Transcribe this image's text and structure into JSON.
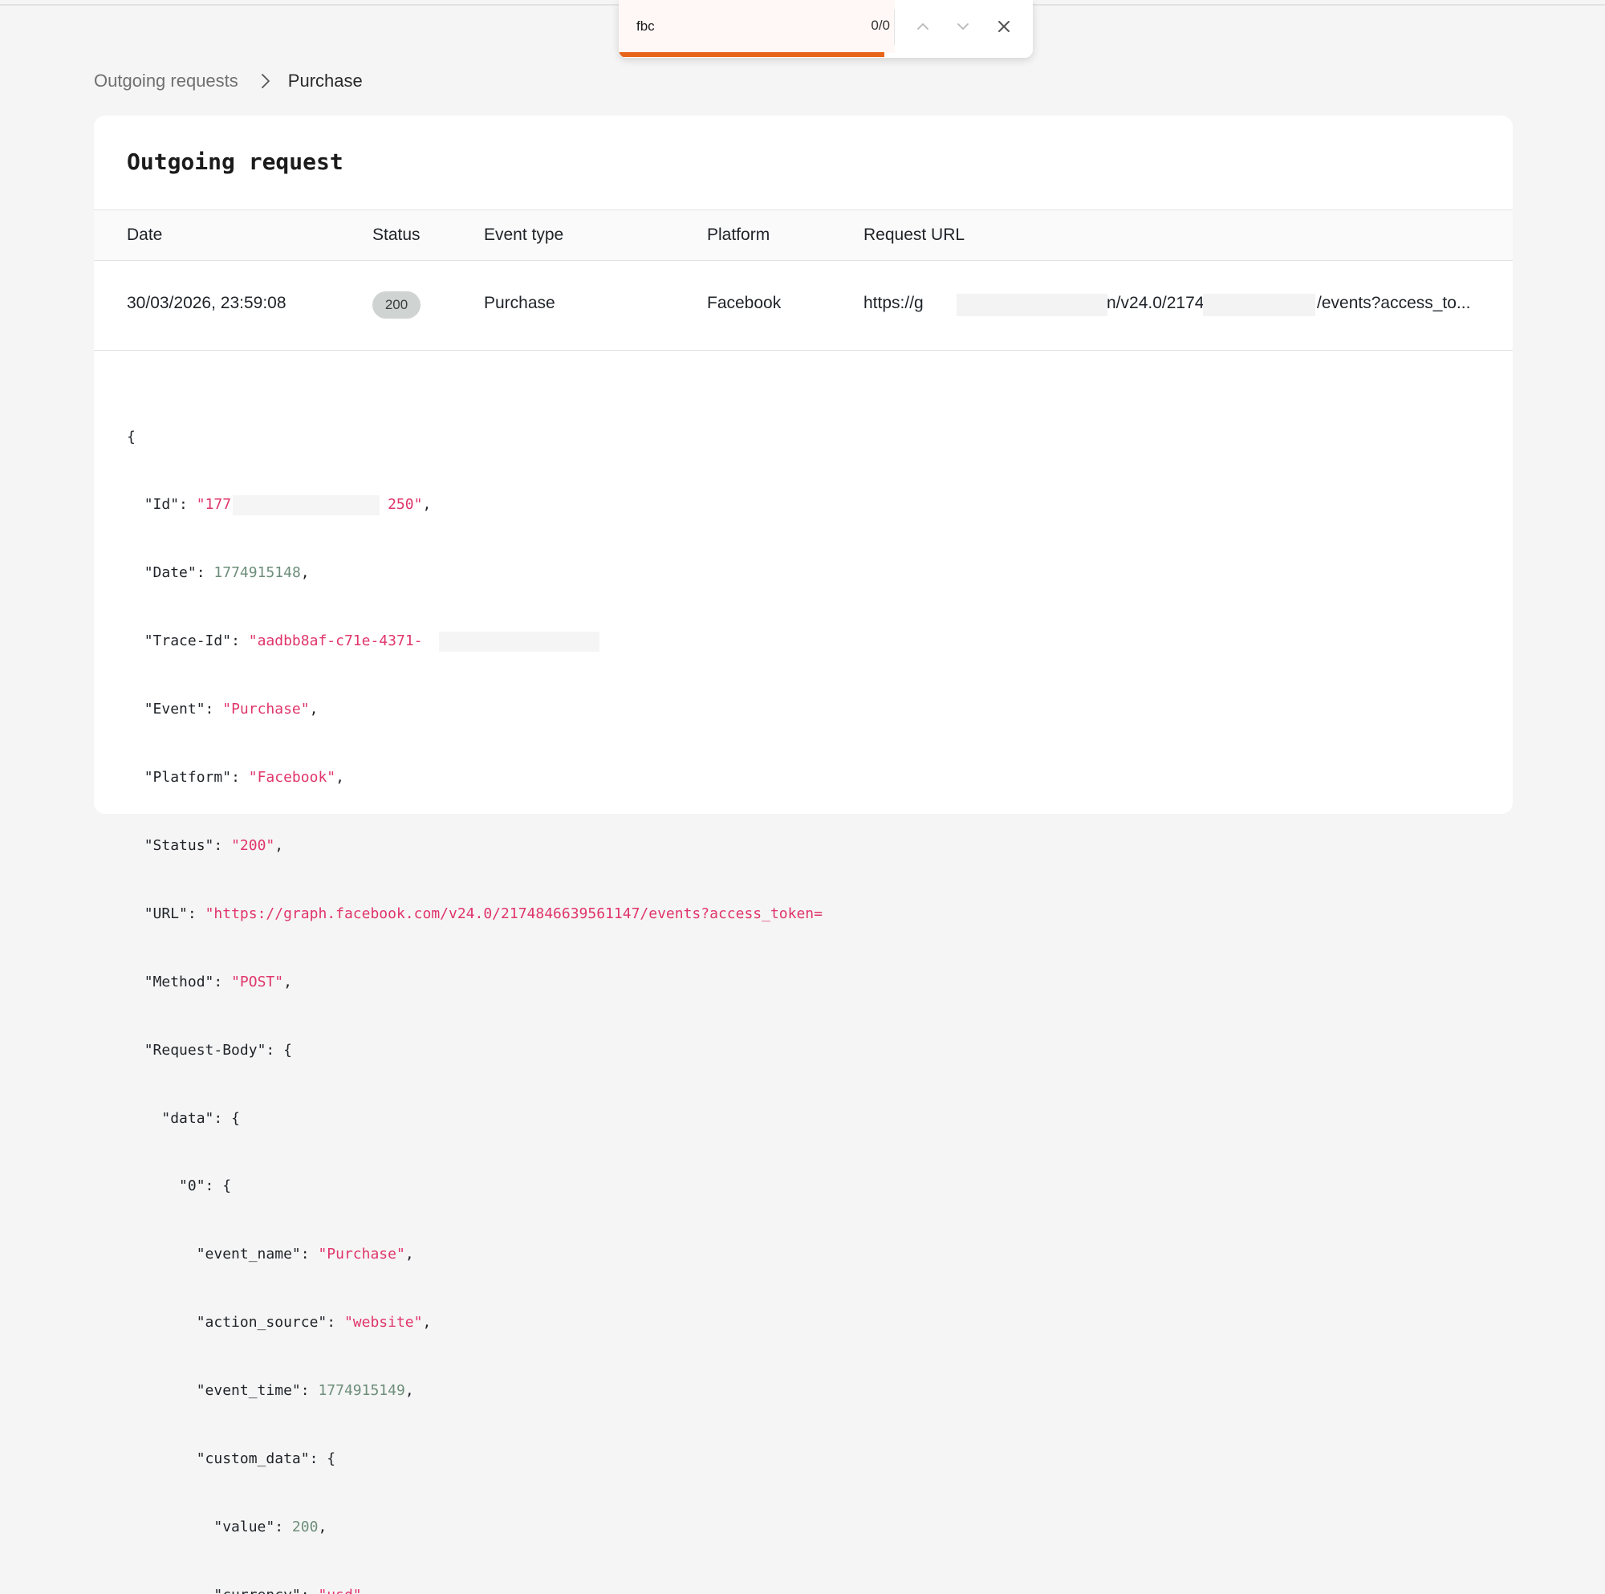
{
  "find_bar": {
    "query": "fbc",
    "match_count": "0/0",
    "icons": {
      "prev": "chevron-up-icon",
      "next": "chevron-down-icon",
      "close": "close-icon"
    }
  },
  "breadcrumb": {
    "parent": "Outgoing requests",
    "current": "Purchase",
    "separator_icon": "chevron-right-icon"
  },
  "card": {
    "title": "Outgoing request",
    "columns": [
      "Date",
      "Status",
      "Event type",
      "Platform",
      "Request URL"
    ],
    "row": {
      "date": "30/03/2026, 23:59:08",
      "status": "200",
      "event_type": "Purchase",
      "platform": "Facebook",
      "url_parts": [
        "https://g",
        "n/v24.0/21748",
        "/events?access_to..."
      ]
    }
  },
  "json_view": {
    "open": "{",
    "id": {
      "key": "\"Id\"",
      "value_start": "\"177",
      "value_end": "250\""
    },
    "date": {
      "key": "\"Date\"",
      "value": "1774915148"
    },
    "trace_id": {
      "key": "\"Trace-Id\"",
      "value_start": "\"aadbb8af-c71e-4371-",
      "value_end": "'"
    },
    "event": {
      "key": "\"Event\"",
      "value": "\"Purchase\""
    },
    "platform": {
      "key": "\"Platform\"",
      "value": "\"Facebook\""
    },
    "status": {
      "key": "\"Status\"",
      "value": "\"200\""
    },
    "url": {
      "key": "\"URL\"",
      "value": "\"https://graph.facebook.com/v24.0/2174846639561147/events?access_token="
    },
    "method": {
      "key": "\"Method\"",
      "value": "\"POST\""
    },
    "request_body": {
      "key": "\"Request-Body\""
    },
    "data": {
      "key": "\"data\""
    },
    "item0": {
      "key": "\"0\""
    },
    "event_name": {
      "key": "\"event_name\"",
      "value": "\"Purchase\""
    },
    "action_source": {
      "key": "\"action_source\"",
      "value": "\"website\""
    },
    "event_time": {
      "key": "\"event_time\"",
      "value": "1774915149"
    },
    "custom_data": {
      "key": "\"custom_data\""
    },
    "value": {
      "key": "\"value\"",
      "value": "200"
    },
    "currency": {
      "key": "\"currency\"",
      "value": "\"usd\""
    }
  },
  "colors": {
    "accent": "#e8641a",
    "string": "#e0356b",
    "number": "#6d8e7a",
    "badge_bg": "#cfd3d1",
    "page_bg": "#f5f5f5"
  }
}
